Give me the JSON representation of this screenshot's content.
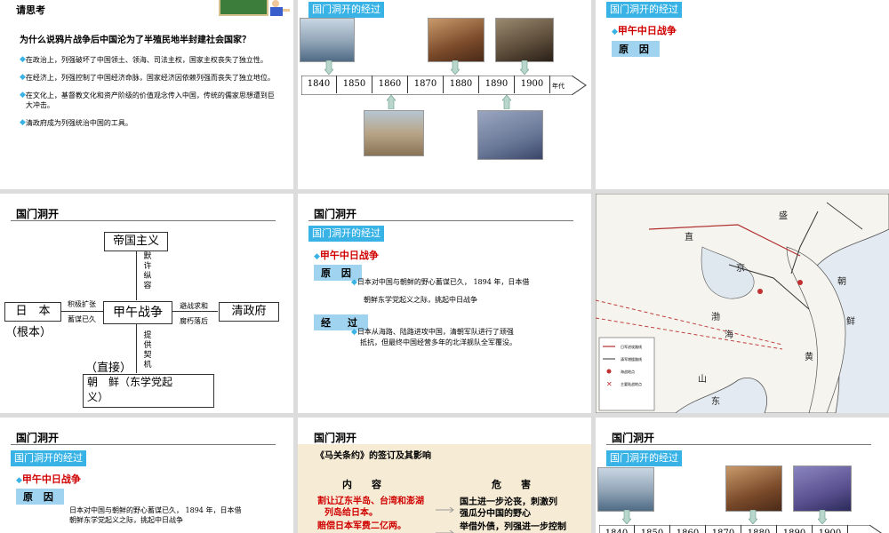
{
  "slide1": {
    "title": "请思考",
    "question": "为什么说鸦片战争后中国沦为了半殖民地半封建社会国家？",
    "points": [
      "在政治上，列强破坏了中国领土、领海、司法主权，国家主权丧失了独立性。",
      "在经济上，列强控制了中国经济命脉，国家经济因依赖列强而丧失了独立地位。",
      "在文化上，基督教文化和资产阶级的价值观念传入中国，传统的儒家思想遭到巨大冲击。",
      "清政府成为列强统治中国的工具。"
    ]
  },
  "slide2": {
    "tag": "国门洞开的经过",
    "years": [
      "1840",
      "1850",
      "1860",
      "1870",
      "1880",
      "1890",
      "1900"
    ],
    "axis_unit": "年代"
  },
  "slide3": {
    "tag": "国门洞开的经过",
    "item": "甲午中日战争",
    "section": "原 因"
  },
  "slide4": {
    "heading": "国门洞开",
    "center": "甲午战争",
    "top_box": "帝国主义",
    "top_label": "默许纵容",
    "left_box": "日　本",
    "left_sub": "（根本）",
    "left_label_top": "积极扩张",
    "left_label_bottom": "蓄谋已久",
    "right_box": "清政府",
    "right_label_top": "避战求和",
    "right_label_bottom": "腐朽落后",
    "bottom_label": "提供契机",
    "bottom_sub": "（直接）",
    "bottom_box_line1": "朝　鲜（东学党起",
    "bottom_box_line2": "义）"
  },
  "slide5": {
    "heading": "国门洞开",
    "tag": "国门洞开的经过",
    "item": "甲午中日战争",
    "section1": "原 因",
    "cause_line1": "日本对中国与朝鲜的野心蓄谋已久， 1894 年，日本借",
    "cause_line2": "朝鲜东学党起义之际，挑起中日战争",
    "section2": "经　过",
    "process_line1": "日本从海路、陆路进攻中国，清朝军队进行了顽强",
    "process_line2": "抵抗，但最终中国经营多年的北洋舰队全军覆没。"
  },
  "slide6": {
    "map_labels": [
      "直",
      "京",
      "渤",
      "海",
      "黄",
      "山",
      "东",
      "朝",
      "鲜",
      "盛"
    ],
    "legend": [
      "日军进攻路线",
      "清军增援路线",
      "海战地点",
      "主要陆战地点"
    ]
  },
  "slide7": {
    "heading": "国门洞开",
    "tag": "国门洞开的经过",
    "item": "甲午中日战争",
    "section": "原 因",
    "cause_line1": "日本对中国与朝鲜的野心蓄谋已久， 1894 年，日本借",
    "cause_line2": "朝鲜东学党起义之际，挑起中日战争"
  },
  "slide8": {
    "heading": "国门洞开",
    "subtitle": "《马关条约》的签订及其影响",
    "col1": "内　　容",
    "col2": "危　　害",
    "content1_line1": "割让辽东半岛、台湾和澎湖",
    "content1_line2": "列岛给日本。",
    "content2": "赔偿日本军费二亿两。",
    "harm1_line1": "国土进一步沦丧，刺激列",
    "harm1_line2": "强瓜分中国的野心",
    "harm2": "举借外债，列强进一步控制"
  },
  "slide9": {
    "heading": "国门洞开",
    "tag": "国门洞开的经过",
    "years": [
      "1840",
      "1850",
      "1860",
      "1870",
      "1880",
      "1890",
      "1900"
    ]
  },
  "colors": {
    "accent_blue": "#39b3e6",
    "section_blue": "#9fd3ef",
    "red": "#d00000",
    "arrow_teal": "#8fb8b0"
  }
}
